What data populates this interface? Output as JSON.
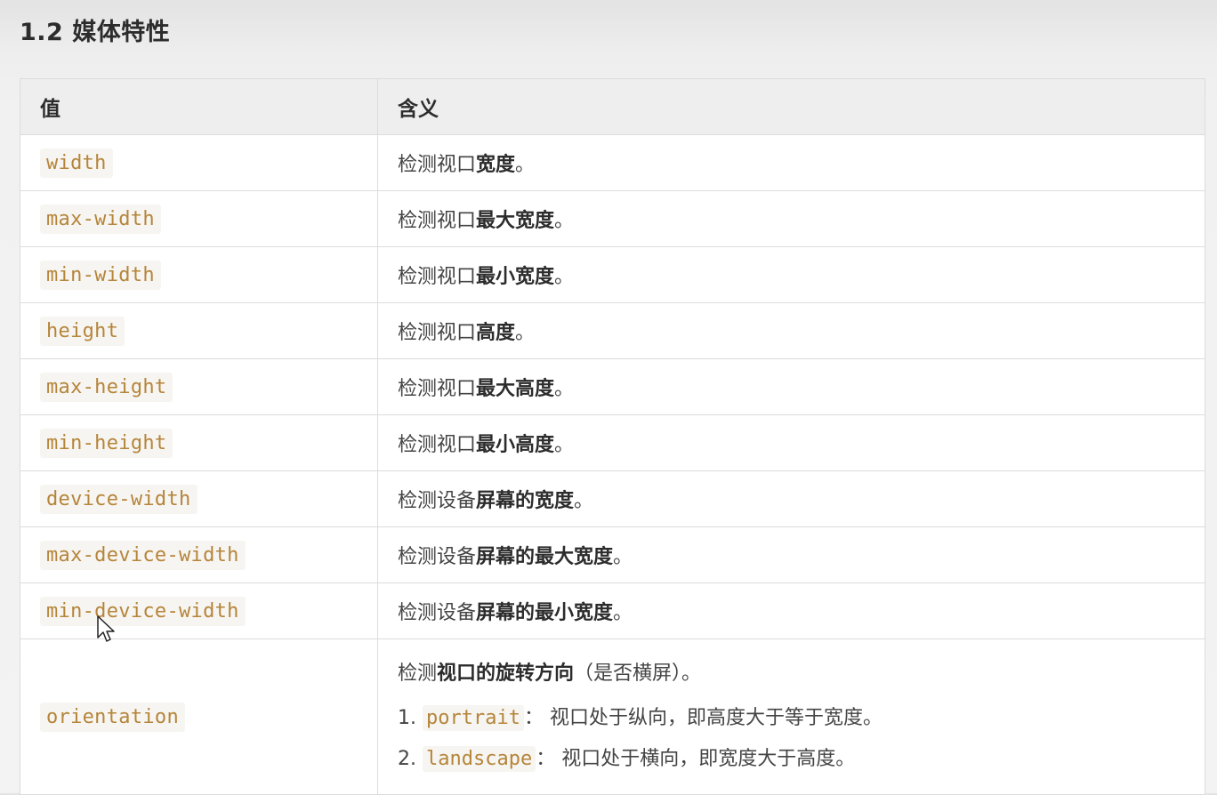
{
  "section": {
    "title": "1.2 媒体特性"
  },
  "table": {
    "headers": [
      "值",
      "含义"
    ],
    "rows": [
      {
        "value": "width",
        "prefix": "检测视口",
        "bold": "宽度",
        "suffix": "。"
      },
      {
        "value": "max-width",
        "prefix": "检测视口",
        "bold": "最大宽度",
        "suffix": "。"
      },
      {
        "value": "min-width",
        "prefix": "检测视口",
        "bold": "最小宽度",
        "suffix": "。"
      },
      {
        "value": "height",
        "prefix": "检测视口",
        "bold": "高度",
        "suffix": "。"
      },
      {
        "value": "max-height",
        "prefix": "检测视口",
        "bold": "最大高度",
        "suffix": "。"
      },
      {
        "value": "min-height",
        "prefix": "检测视口",
        "bold": "最小高度",
        "suffix": "。"
      },
      {
        "value": "device-width",
        "prefix": "检测设备",
        "bold": "屏幕的宽度",
        "suffix": "。"
      },
      {
        "value": "max-device-width",
        "prefix": "检测设备",
        "bold": "屏幕的最大宽度",
        "suffix": "。"
      },
      {
        "value": "min-device-width",
        "prefix": "检测设备",
        "bold": "屏幕的最小宽度",
        "suffix": "。"
      }
    ],
    "orientation": {
      "value": "orientation",
      "prefix": "检测",
      "bold": "视口的旋转方向",
      "suffix": "（是否横屏）。",
      "items": [
        {
          "num": "1.",
          "code": "portrait",
          "text": "： 视口处于纵向，即高度大于等于宽度。"
        },
        {
          "num": "2.",
          "code": "landscape",
          "text": "： 视口处于横向，即宽度大于高度。"
        }
      ]
    }
  },
  "colors": {
    "code_text": "#b5853a",
    "code_bg": "#f7f5f2",
    "header_bg": "#eeeeee",
    "border": "#dcdcdc"
  },
  "icons": {
    "cursor": "mouse-pointer-icon"
  }
}
